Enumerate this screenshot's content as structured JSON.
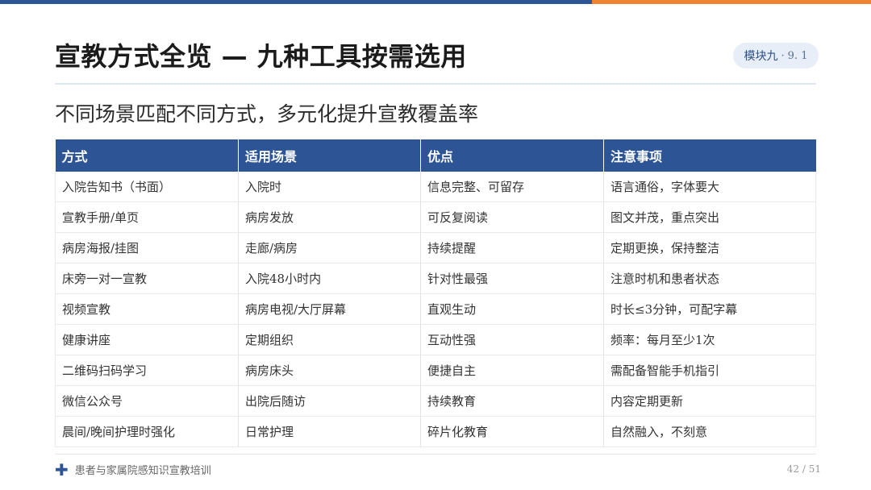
{
  "colors": {
    "brand_blue": "#2d5596",
    "accent_orange": "#ee8432",
    "badge_bg": "#e8eef7"
  },
  "title": "宣教方式全览 — 九种工具按需选用",
  "badge": {
    "module": "模块九",
    "separator": "·",
    "number": "9. 1"
  },
  "subtitle": "不同场景匹配不同方式，多元化提升宣教覆盖率",
  "table": {
    "headers": [
      "方式",
      "适用场景",
      "优点",
      "注意事项"
    ],
    "rows": [
      [
        "入院告知书（书面）",
        "入院时",
        "信息完整、可留存",
        "语言通俗，字体要大"
      ],
      [
        "宣教手册/单页",
        "病房发放",
        "可反复阅读",
        "图文并茂，重点突出"
      ],
      [
        "病房海报/挂图",
        "走廊/病房",
        "持续提醒",
        "定期更换，保持整洁"
      ],
      [
        "床旁一对一宣教",
        "入院48小时内",
        "针对性最强",
        "注意时机和患者状态"
      ],
      [
        "视频宣教",
        "病房电视/大厅屏幕",
        "直观生动",
        "时长≤3分钟，可配字幕"
      ],
      [
        "健康讲座",
        "定期组织",
        "互动性强",
        "频率：每月至少1次"
      ],
      [
        "二维码扫码学习",
        "病房床头",
        "便捷自主",
        "需配备智能手机指引"
      ],
      [
        "微信公众号",
        "出院后随访",
        "持续教育",
        "内容定期更新"
      ],
      [
        "晨间/晚间护理时强化",
        "日常护理",
        "碎片化教育",
        "自然融入，不刻意"
      ]
    ]
  },
  "footer": {
    "icon": "plus-icon",
    "text": "患者与家属院感知识宣教培训",
    "page": "42 / 51"
  }
}
